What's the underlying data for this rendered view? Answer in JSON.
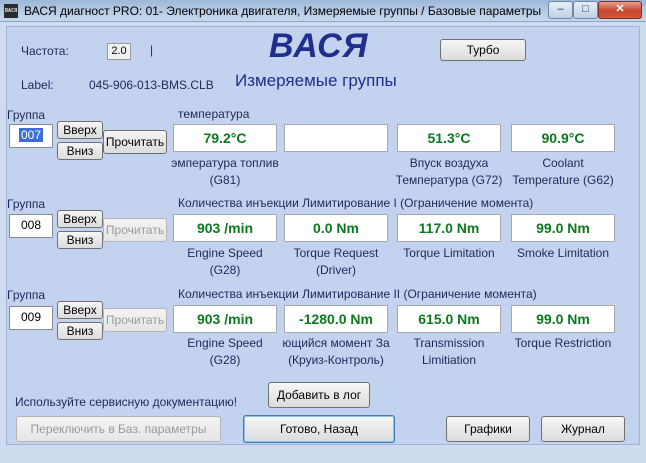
{
  "window": {
    "icon_text": "ВАСЯ",
    "title": "ВАСЯ диагност PRO: 01- Электроника двигателя,  Измеряемые группы / Базовые параметры",
    "minimize": "–",
    "maximize": "□",
    "close": "✕"
  },
  "header": {
    "frequency_label": "Частота:",
    "frequency_value": "2.0",
    "frequency_suffix": "|",
    "logo": "ВАСЯ",
    "turbo_button": "Турбо",
    "label_caption": "Label:",
    "label_value": "045-906-013-BMS.CLB",
    "section_title": "Измеряемые группы"
  },
  "groups": [
    {
      "group_label": "Группа",
      "number": "007",
      "up": "Вверх",
      "down": "Вниз",
      "read": "Прочитать",
      "read_enabled": true,
      "title": "температура",
      "cells": [
        {
          "value": "79.2°C",
          "label": "эмпература топлив\n(G81)"
        },
        {
          "value": "",
          "label": ""
        },
        {
          "value": "51.3°C",
          "label": "Впуск воздуха\nТемпература (G72)"
        },
        {
          "value": "90.9°C",
          "label": "Coolant\nTemperature (G62)"
        }
      ]
    },
    {
      "group_label": "Группа",
      "number": "008",
      "up": "Вверх",
      "down": "Вниз",
      "read": "Прочитать",
      "read_enabled": false,
      "title": "Количества инъекции Лимитирование I (Ограничение момента)",
      "cells": [
        {
          "value": "903 /min",
          "label": "Engine Speed\n(G28)"
        },
        {
          "value": "0.0 Nm",
          "label": "Torque Request\n(Driver)"
        },
        {
          "value": "117.0 Nm",
          "label": "Torque Limitation"
        },
        {
          "value": "99.0 Nm",
          "label": "Smoke Limitation"
        }
      ]
    },
    {
      "group_label": "Группа",
      "number": "009",
      "up": "Вверх",
      "down": "Вниз",
      "read": "Прочитать",
      "read_enabled": false,
      "title": "Количества инъекции Лимитирование II (Ограничение момента)",
      "cells": [
        {
          "value": "903 /min",
          "label": "Engine Speed\n(G28)"
        },
        {
          "value": "-1280.0 Nm",
          "label": "ющийся момент За\n(Круиз-Контроль)"
        },
        {
          "value": "615.0 Nm",
          "label": "Transmission\nLimitiation"
        },
        {
          "value": "99.0 Nm",
          "label": "Torque Restriction"
        }
      ]
    }
  ],
  "footer": {
    "hint": "Используйте сервисную документацию!",
    "add_log": "Добавить в лог",
    "switch_basic": "Переключить в Баз. параметры",
    "done_back": "Готово, Назад",
    "graphs": "Графики",
    "journal": "Журнал"
  },
  "colors": {
    "value_text": "#0a7a1e",
    "background": "#c3d2ee",
    "brand": "#1f2f8c"
  }
}
